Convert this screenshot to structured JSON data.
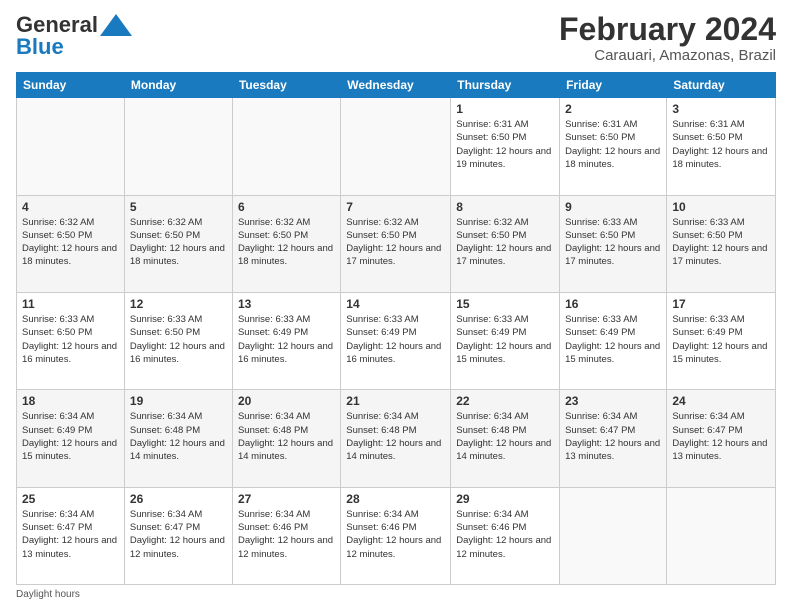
{
  "logo": {
    "part1": "General",
    "part2": "Blue"
  },
  "title": "February 2024",
  "subtitle": "Carauari, Amazonas, Brazil",
  "days_of_week": [
    "Sunday",
    "Monday",
    "Tuesday",
    "Wednesday",
    "Thursday",
    "Friday",
    "Saturday"
  ],
  "footer": "Daylight hours",
  "weeks": [
    [
      {
        "day": "",
        "sunrise": "",
        "sunset": "",
        "daylight": ""
      },
      {
        "day": "",
        "sunrise": "",
        "sunset": "",
        "daylight": ""
      },
      {
        "day": "",
        "sunrise": "",
        "sunset": "",
        "daylight": ""
      },
      {
        "day": "",
        "sunrise": "",
        "sunset": "",
        "daylight": ""
      },
      {
        "day": "1",
        "sunrise": "Sunrise: 6:31 AM",
        "sunset": "Sunset: 6:50 PM",
        "daylight": "Daylight: 12 hours and 19 minutes."
      },
      {
        "day": "2",
        "sunrise": "Sunrise: 6:31 AM",
        "sunset": "Sunset: 6:50 PM",
        "daylight": "Daylight: 12 hours and 18 minutes."
      },
      {
        "day": "3",
        "sunrise": "Sunrise: 6:31 AM",
        "sunset": "Sunset: 6:50 PM",
        "daylight": "Daylight: 12 hours and 18 minutes."
      }
    ],
    [
      {
        "day": "4",
        "sunrise": "Sunrise: 6:32 AM",
        "sunset": "Sunset: 6:50 PM",
        "daylight": "Daylight: 12 hours and 18 minutes."
      },
      {
        "day": "5",
        "sunrise": "Sunrise: 6:32 AM",
        "sunset": "Sunset: 6:50 PM",
        "daylight": "Daylight: 12 hours and 18 minutes."
      },
      {
        "day": "6",
        "sunrise": "Sunrise: 6:32 AM",
        "sunset": "Sunset: 6:50 PM",
        "daylight": "Daylight: 12 hours and 18 minutes."
      },
      {
        "day": "7",
        "sunrise": "Sunrise: 6:32 AM",
        "sunset": "Sunset: 6:50 PM",
        "daylight": "Daylight: 12 hours and 17 minutes."
      },
      {
        "day": "8",
        "sunrise": "Sunrise: 6:32 AM",
        "sunset": "Sunset: 6:50 PM",
        "daylight": "Daylight: 12 hours and 17 minutes."
      },
      {
        "day": "9",
        "sunrise": "Sunrise: 6:33 AM",
        "sunset": "Sunset: 6:50 PM",
        "daylight": "Daylight: 12 hours and 17 minutes."
      },
      {
        "day": "10",
        "sunrise": "Sunrise: 6:33 AM",
        "sunset": "Sunset: 6:50 PM",
        "daylight": "Daylight: 12 hours and 17 minutes."
      }
    ],
    [
      {
        "day": "11",
        "sunrise": "Sunrise: 6:33 AM",
        "sunset": "Sunset: 6:50 PM",
        "daylight": "Daylight: 12 hours and 16 minutes."
      },
      {
        "day": "12",
        "sunrise": "Sunrise: 6:33 AM",
        "sunset": "Sunset: 6:50 PM",
        "daylight": "Daylight: 12 hours and 16 minutes."
      },
      {
        "day": "13",
        "sunrise": "Sunrise: 6:33 AM",
        "sunset": "Sunset: 6:49 PM",
        "daylight": "Daylight: 12 hours and 16 minutes."
      },
      {
        "day": "14",
        "sunrise": "Sunrise: 6:33 AM",
        "sunset": "Sunset: 6:49 PM",
        "daylight": "Daylight: 12 hours and 16 minutes."
      },
      {
        "day": "15",
        "sunrise": "Sunrise: 6:33 AM",
        "sunset": "Sunset: 6:49 PM",
        "daylight": "Daylight: 12 hours and 15 minutes."
      },
      {
        "day": "16",
        "sunrise": "Sunrise: 6:33 AM",
        "sunset": "Sunset: 6:49 PM",
        "daylight": "Daylight: 12 hours and 15 minutes."
      },
      {
        "day": "17",
        "sunrise": "Sunrise: 6:33 AM",
        "sunset": "Sunset: 6:49 PM",
        "daylight": "Daylight: 12 hours and 15 minutes."
      }
    ],
    [
      {
        "day": "18",
        "sunrise": "Sunrise: 6:34 AM",
        "sunset": "Sunset: 6:49 PM",
        "daylight": "Daylight: 12 hours and 15 minutes."
      },
      {
        "day": "19",
        "sunrise": "Sunrise: 6:34 AM",
        "sunset": "Sunset: 6:48 PM",
        "daylight": "Daylight: 12 hours and 14 minutes."
      },
      {
        "day": "20",
        "sunrise": "Sunrise: 6:34 AM",
        "sunset": "Sunset: 6:48 PM",
        "daylight": "Daylight: 12 hours and 14 minutes."
      },
      {
        "day": "21",
        "sunrise": "Sunrise: 6:34 AM",
        "sunset": "Sunset: 6:48 PM",
        "daylight": "Daylight: 12 hours and 14 minutes."
      },
      {
        "day": "22",
        "sunrise": "Sunrise: 6:34 AM",
        "sunset": "Sunset: 6:48 PM",
        "daylight": "Daylight: 12 hours and 14 minutes."
      },
      {
        "day": "23",
        "sunrise": "Sunrise: 6:34 AM",
        "sunset": "Sunset: 6:47 PM",
        "daylight": "Daylight: 12 hours and 13 minutes."
      },
      {
        "day": "24",
        "sunrise": "Sunrise: 6:34 AM",
        "sunset": "Sunset: 6:47 PM",
        "daylight": "Daylight: 12 hours and 13 minutes."
      }
    ],
    [
      {
        "day": "25",
        "sunrise": "Sunrise: 6:34 AM",
        "sunset": "Sunset: 6:47 PM",
        "daylight": "Daylight: 12 hours and 13 minutes."
      },
      {
        "day": "26",
        "sunrise": "Sunrise: 6:34 AM",
        "sunset": "Sunset: 6:47 PM",
        "daylight": "Daylight: 12 hours and 12 minutes."
      },
      {
        "day": "27",
        "sunrise": "Sunrise: 6:34 AM",
        "sunset": "Sunset: 6:46 PM",
        "daylight": "Daylight: 12 hours and 12 minutes."
      },
      {
        "day": "28",
        "sunrise": "Sunrise: 6:34 AM",
        "sunset": "Sunset: 6:46 PM",
        "daylight": "Daylight: 12 hours and 12 minutes."
      },
      {
        "day": "29",
        "sunrise": "Sunrise: 6:34 AM",
        "sunset": "Sunset: 6:46 PM",
        "daylight": "Daylight: 12 hours and 12 minutes."
      },
      {
        "day": "",
        "sunrise": "",
        "sunset": "",
        "daylight": ""
      },
      {
        "day": "",
        "sunrise": "",
        "sunset": "",
        "daylight": ""
      }
    ]
  ]
}
